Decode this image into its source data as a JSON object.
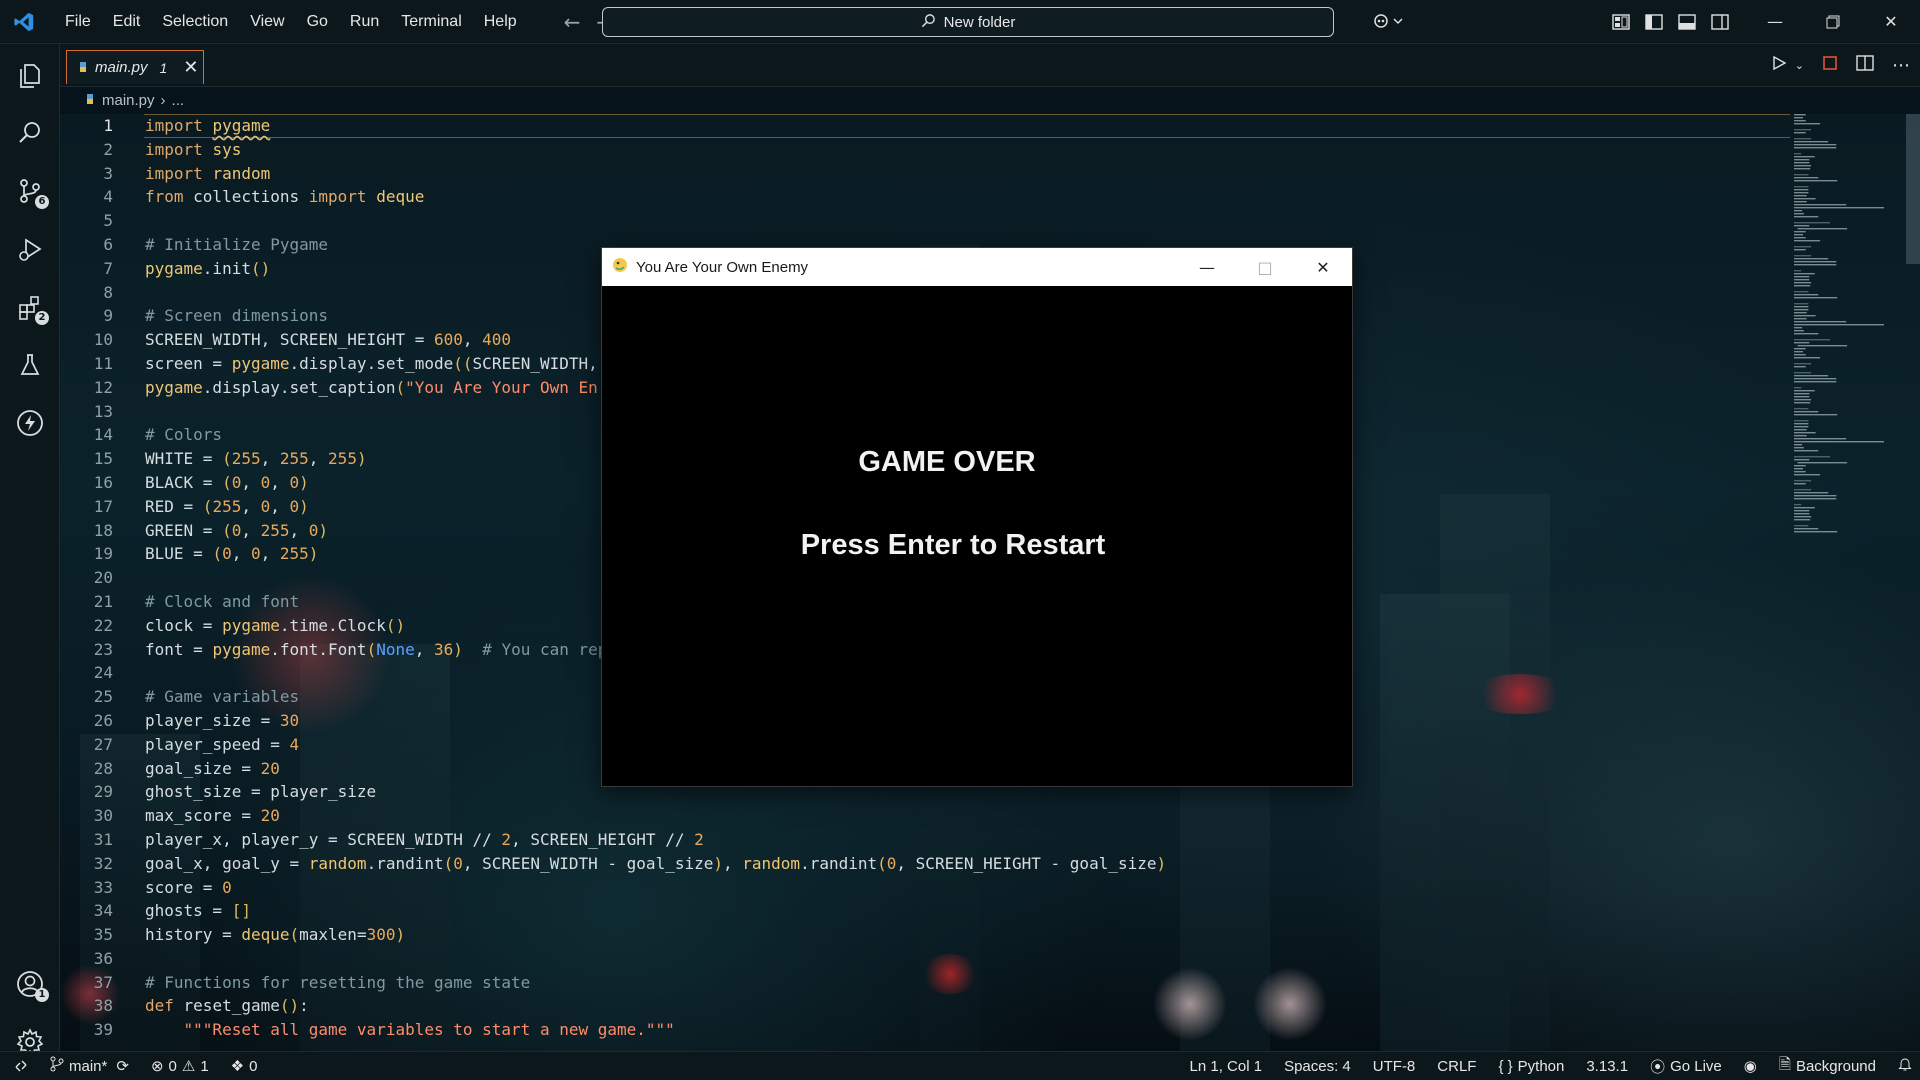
{
  "window": {
    "search_text": "New folder"
  },
  "menu": [
    "File",
    "Edit",
    "Selection",
    "View",
    "Go",
    "Run",
    "Terminal",
    "Help"
  ],
  "activity_bar": {
    "source_control_badge": "6",
    "extensions_badge": "2",
    "accounts_badge": "1"
  },
  "tab": {
    "name": "main.py",
    "problems": "1"
  },
  "breadcrumb": {
    "file": "main.py",
    "rest": "..."
  },
  "code_lines": [
    "import pygame",
    "import sys",
    "import random",
    "from collections import deque",
    "",
    "# Initialize Pygame",
    "pygame.init()",
    "",
    "# Screen dimensions",
    "SCREEN_WIDTH, SCREEN_HEIGHT = 600, 400",
    "screen = pygame.display.set_mode((SCREEN_WIDTH,",
    "pygame.display.set_caption(\"You Are Your Own En",
    "",
    "# Colors",
    "WHITE = (255, 255, 255)",
    "BLACK = (0, 0, 0)",
    "RED = (255, 0, 0)",
    "GREEN = (0, 255, 0)",
    "BLUE = (0, 0, 255)",
    "",
    "# Clock and font",
    "clock = pygame.time.Clock()",
    "font = pygame.font.Font(None, 36)  # You can rep",
    "",
    "# Game variables",
    "player_size = 30",
    "player_speed = 4",
    "goal_size = 20",
    "ghost_size = player_size",
    "max_score = 20",
    "player_x, player_y = SCREEN_WIDTH // 2, SCREEN_HEIGHT // 2",
    "goal_x, goal_y = random.randint(0, SCREEN_WIDTH - goal_size), random.randint(0, SCREEN_HEIGHT - goal_size)",
    "score = 0",
    "ghosts = []",
    "history = deque(maxlen=300)",
    "",
    "# Functions for resetting the game state",
    "def reset_game():",
    "    \"\"\"Reset all game variables to start a new game.\"\"\""
  ],
  "game_window": {
    "title": "You Are Your Own Enemy",
    "game_over": "GAME OVER",
    "restart": "Press Enter to Restart"
  },
  "status_bar": {
    "branch": "main*",
    "errors": "0",
    "warnings": "1",
    "ports": "0",
    "position": "Ln 1, Col 1",
    "spaces": "Spaces: 4",
    "encoding": "UTF-8",
    "eol": "CRLF",
    "language": "Python",
    "interpreter": "3.13.1",
    "go_live": "Go Live",
    "background": "Background"
  }
}
